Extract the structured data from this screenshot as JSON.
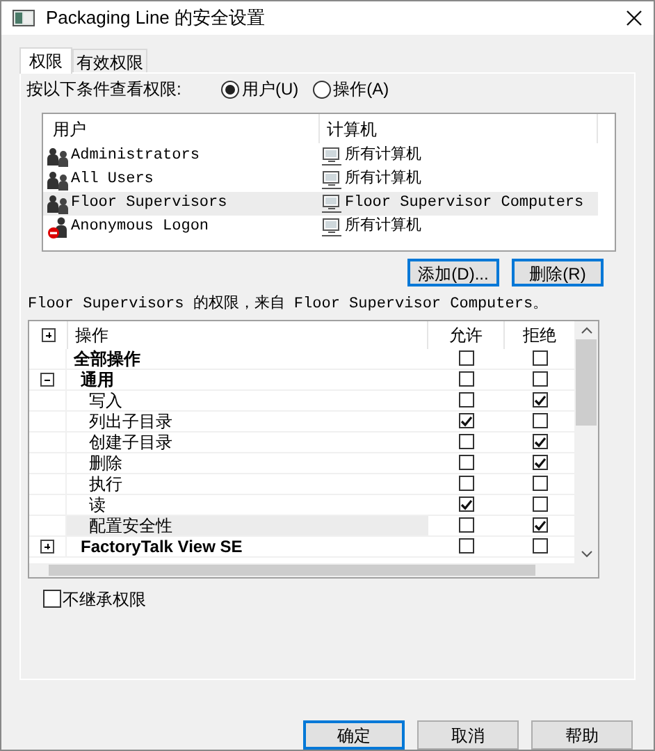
{
  "window": {
    "title": "Packaging Line 的安全设置"
  },
  "tabs": [
    {
      "label": "权限",
      "selected": true
    },
    {
      "label": "有效权限",
      "selected": false
    }
  ],
  "view_by": {
    "label": "按以下条件查看权限:",
    "options": [
      {
        "label": "用户(U)",
        "selected": true
      },
      {
        "label": "操作(A)",
        "selected": false
      }
    ]
  },
  "users_table": {
    "columns": [
      "用户",
      "计算机"
    ],
    "rows": [
      {
        "kind": "group",
        "user": "Administrators",
        "computer": "所有计算机",
        "selected": false
      },
      {
        "kind": "group",
        "user": "All Users",
        "computer": "所有计算机",
        "selected": false
      },
      {
        "kind": "group",
        "user": "Floor Supervisors",
        "computer": "Floor Supervisor Computers",
        "selected": true
      },
      {
        "kind": "anonymous",
        "user": "Anonymous Logon",
        "computer": "所有计算机",
        "selected": false
      }
    ]
  },
  "user_buttons": [
    "添加(D)...",
    "删除(R)"
  ],
  "permissions_caption": "Floor Supervisors 的权限，来自 Floor Supervisor Computers。",
  "permissions": {
    "columns": [
      "操作",
      "允许",
      "拒绝"
    ],
    "tree": [
      {
        "label": "全部操作",
        "allow": false,
        "deny": false,
        "selected": false,
        "children": [
          {
            "label": "通用",
            "expanded": true,
            "allow": false,
            "deny": false,
            "selected": false,
            "children": [
              {
                "label": "写入",
                "allow": false,
                "deny": true,
                "selected": false
              },
              {
                "label": "列出子目录",
                "allow": true,
                "deny": false,
                "selected": false
              },
              {
                "label": "创建子目录",
                "allow": false,
                "deny": true,
                "selected": false
              },
              {
                "label": "删除",
                "allow": false,
                "deny": true,
                "selected": false
              },
              {
                "label": "执行",
                "allow": false,
                "deny": false,
                "selected": false
              },
              {
                "label": "读",
                "allow": true,
                "deny": false,
                "selected": false
              },
              {
                "label": "配置安全性",
                "allow": false,
                "deny": true,
                "selected": true
              }
            ]
          },
          {
            "label": "FactoryTalk View SE",
            "expanded": false,
            "allow": false,
            "deny": false,
            "selected": false
          }
        ]
      }
    ]
  },
  "inherit_checkbox": {
    "label": "不继承权限",
    "checked": false
  },
  "buttons": [
    {
      "label": "确定",
      "default": true
    },
    {
      "label": "取消",
      "default": false
    },
    {
      "label": "帮助",
      "default": false
    }
  ]
}
